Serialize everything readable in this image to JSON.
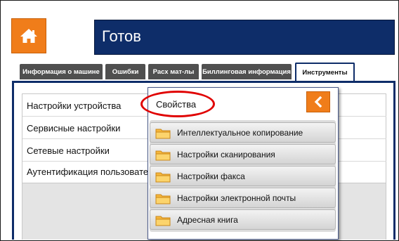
{
  "header": {
    "home_icon": "home-icon",
    "status_title": "Готов"
  },
  "tabs": [
    {
      "label": "Информация о машине",
      "active": false
    },
    {
      "label": "Ошибки",
      "active": false
    },
    {
      "label": "Расх мат-лы",
      "active": false
    },
    {
      "label": "Биллинговая информация",
      "active": false
    },
    {
      "label": "Инструменты",
      "active": true
    }
  ],
  "left_list": {
    "items": [
      {
        "label": "Настройки устройства"
      },
      {
        "label": "Сервисные настройки"
      },
      {
        "label": "Сетевые настройки"
      },
      {
        "label": "Аутентификация пользователя"
      }
    ]
  },
  "popup": {
    "title": "Свойства",
    "back_icon": "chevron-left-icon",
    "items": [
      {
        "label": "Интеллектуальное копирование",
        "icon": "folder-icon"
      },
      {
        "label": "Настройки сканирования",
        "icon": "folder-icon"
      },
      {
        "label": "Настройки факса",
        "icon": "folder-icon"
      },
      {
        "label": "Настройки электронной почты",
        "icon": "folder-icon"
      },
      {
        "label": "Адресная книга",
        "icon": "folder-icon"
      }
    ]
  },
  "colors": {
    "accent_orange": "#f07d1a",
    "title_navy": "#0e2d69",
    "tab_grey": "#4f4f4f",
    "highlight_red": "#e00000"
  }
}
